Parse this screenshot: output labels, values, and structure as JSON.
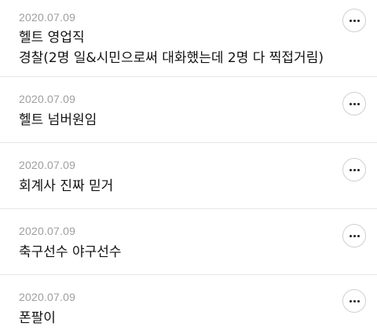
{
  "comments": [
    {
      "date": "2020.07.09",
      "lines": [
        "헬트 영업직",
        "경찰(2명 일&시민으로써 대화했는데 2명 다 찍접거림)"
      ],
      "menu_icon": "more-horizontal-icon"
    },
    {
      "date": "2020.07.09",
      "lines": [
        "헬트 넘버원임"
      ],
      "menu_icon": "more-horizontal-icon"
    },
    {
      "date": "2020.07.09",
      "lines": [
        "회계사 진짜 믿거"
      ],
      "menu_icon": "more-horizontal-icon"
    },
    {
      "date": "2020.07.09",
      "lines": [
        "축구선수 야구선수"
      ],
      "menu_icon": "more-horizontal-icon"
    },
    {
      "date": "2020.07.09",
      "lines": [
        "폰팔이"
      ],
      "menu_icon": "more-horizontal-icon"
    }
  ]
}
